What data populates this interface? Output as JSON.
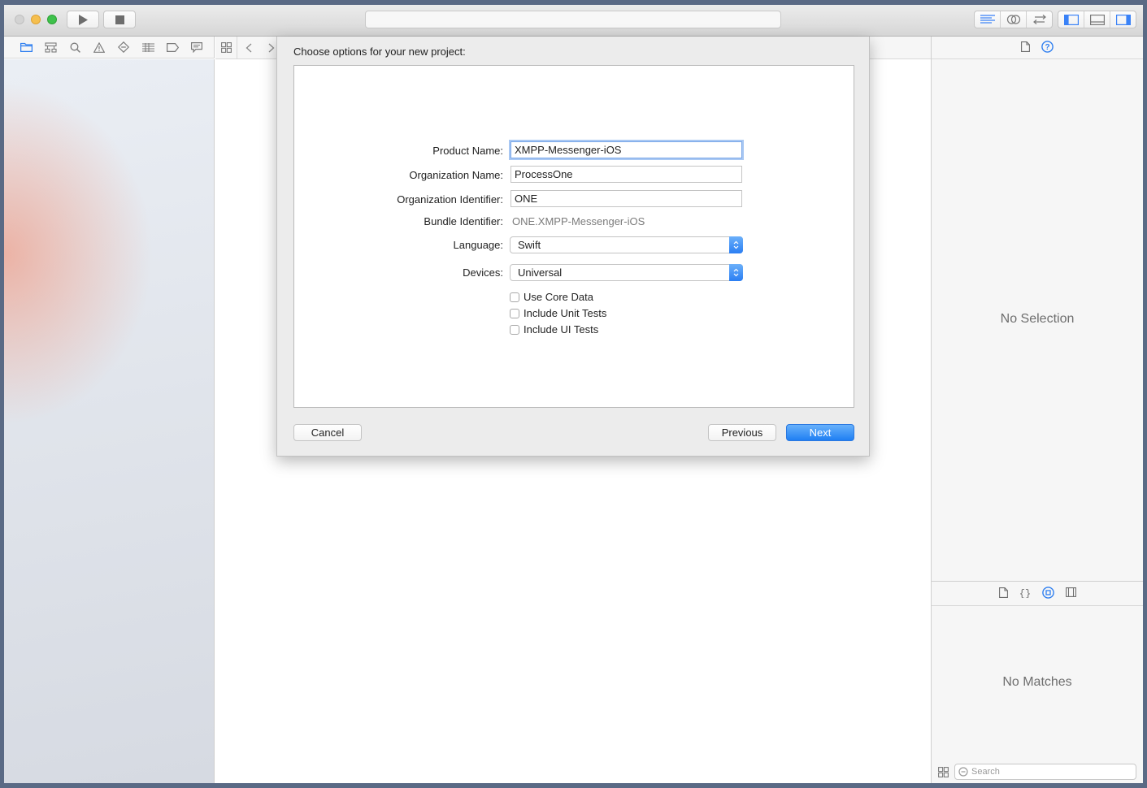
{
  "toolbar": {
    "activity_text": ""
  },
  "dialog": {
    "title": "Choose options for your new project:",
    "fields": {
      "product_name": {
        "label": "Product Name:",
        "value": "XMPP-Messenger-iOS"
      },
      "org_name": {
        "label": "Organization Name:",
        "value": "ProcessOne"
      },
      "org_identifier": {
        "label": "Organization Identifier:",
        "value": "ONE"
      },
      "bundle_identifier": {
        "label": "Bundle Identifier:",
        "value": "ONE.XMPP-Messenger-iOS"
      },
      "language": {
        "label": "Language:",
        "value": "Swift"
      },
      "devices": {
        "label": "Devices:",
        "value": "Universal"
      }
    },
    "checkboxes": [
      {
        "label": "Use Core Data",
        "checked": false
      },
      {
        "label": "Include Unit Tests",
        "checked": false
      },
      {
        "label": "Include UI Tests",
        "checked": false
      }
    ],
    "buttons": {
      "cancel": "Cancel",
      "previous": "Previous",
      "next": "Next"
    }
  },
  "inspector": {
    "no_selection": "No Selection",
    "no_matches": "No Matches",
    "search_placeholder": "Search"
  },
  "colors": {
    "accent": "#2a7ef3",
    "close": "#cfcfcf",
    "minimize": "#f5bf4f",
    "zoom": "#3ec14b"
  }
}
